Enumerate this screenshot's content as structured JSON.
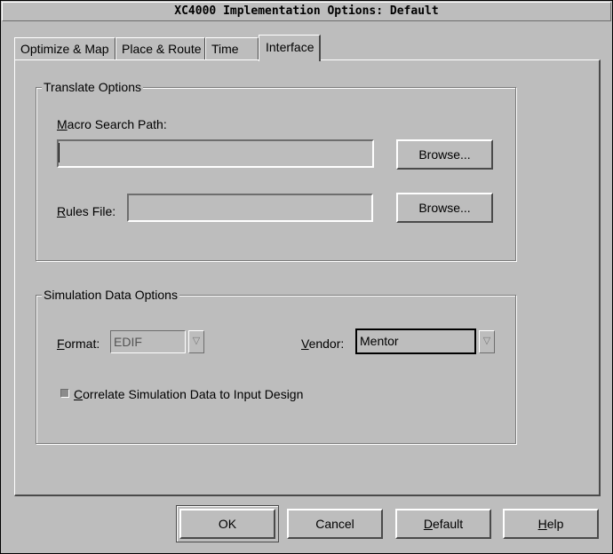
{
  "window": {
    "title": "XC4000 Implementation Options: Default"
  },
  "tabs": [
    {
      "label": "Optimize & Map"
    },
    {
      "label": "Place & Route"
    },
    {
      "label": "Time"
    },
    {
      "label": "Interface",
      "active": true
    }
  ],
  "translate": {
    "group_label": "Translate Options",
    "macro_search_path_label": "Macro Search Path:",
    "macro_search_path_value": "",
    "browse1_label": "Browse...",
    "rules_file_label": "Rules File:",
    "rules_file_value": "",
    "browse2_label": "Browse..."
  },
  "simulation": {
    "group_label": "Simulation Data Options",
    "format_label": "Format:",
    "format_value": "EDIF",
    "vendor_label": "Vendor:",
    "vendor_value": "Mentor",
    "correlate_label": "Correlate Simulation Data to Input Design",
    "correlate_checked": true
  },
  "buttons": {
    "ok": "OK",
    "cancel": "Cancel",
    "default": "Default",
    "help": "Help"
  },
  "icons": {
    "dropdown": "chevron-down-icon"
  }
}
